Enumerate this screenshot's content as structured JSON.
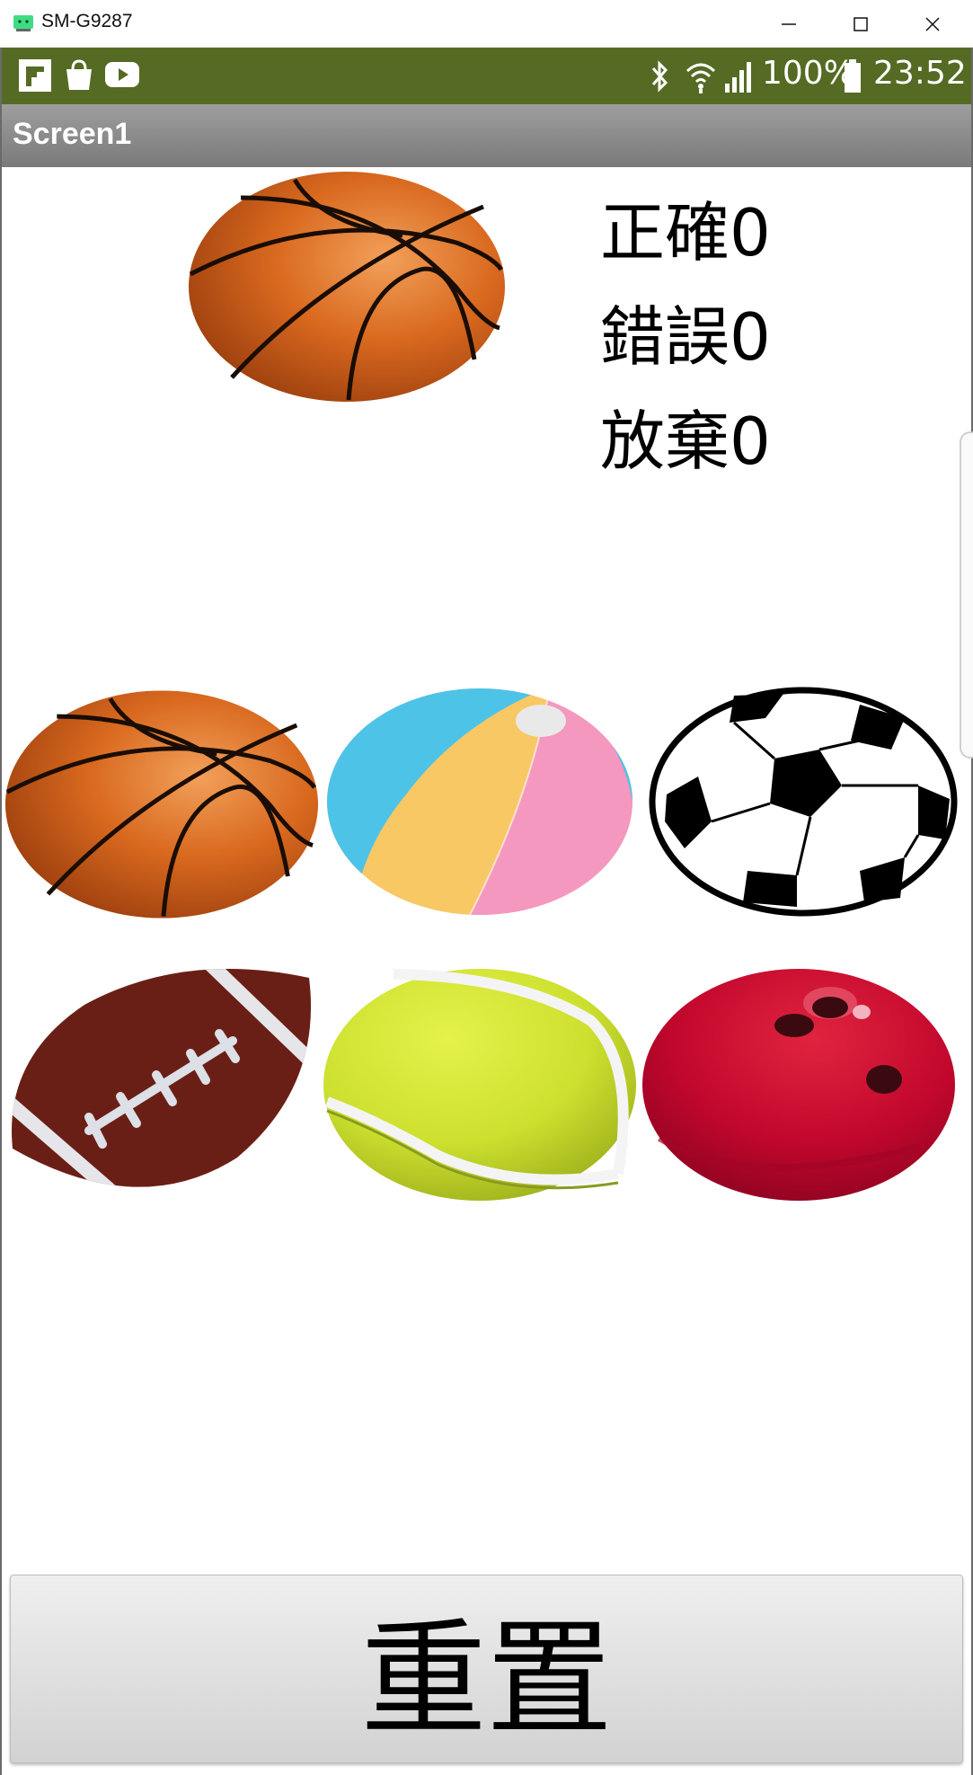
{
  "window": {
    "title": "SM-G9287",
    "minimize_icon": "minimize-icon",
    "maximize_icon": "maximize-icon",
    "close_icon": "close-icon"
  },
  "status_bar": {
    "color": "#556b24",
    "notification_icons": [
      "flipboard-icon",
      "shopping-bag-icon",
      "youtube-icon"
    ],
    "system_icons": [
      "bluetooth-icon",
      "wifi-icon",
      "signal-icon",
      "battery-icon"
    ],
    "battery": "100%",
    "time": "23:52"
  },
  "app_bar": {
    "title": "Screen1"
  },
  "target_ball": "basketball",
  "scores": {
    "correct_label": "正確",
    "correct_value": "0",
    "wrong_label": "錯誤",
    "wrong_value": "0",
    "giveup_label": "放棄",
    "giveup_value": "0"
  },
  "choices": [
    "basketball",
    "beach-ball",
    "soccer-ball",
    "football",
    "tennis-ball",
    "bowling-ball"
  ],
  "reset_button": {
    "label": "重置"
  }
}
